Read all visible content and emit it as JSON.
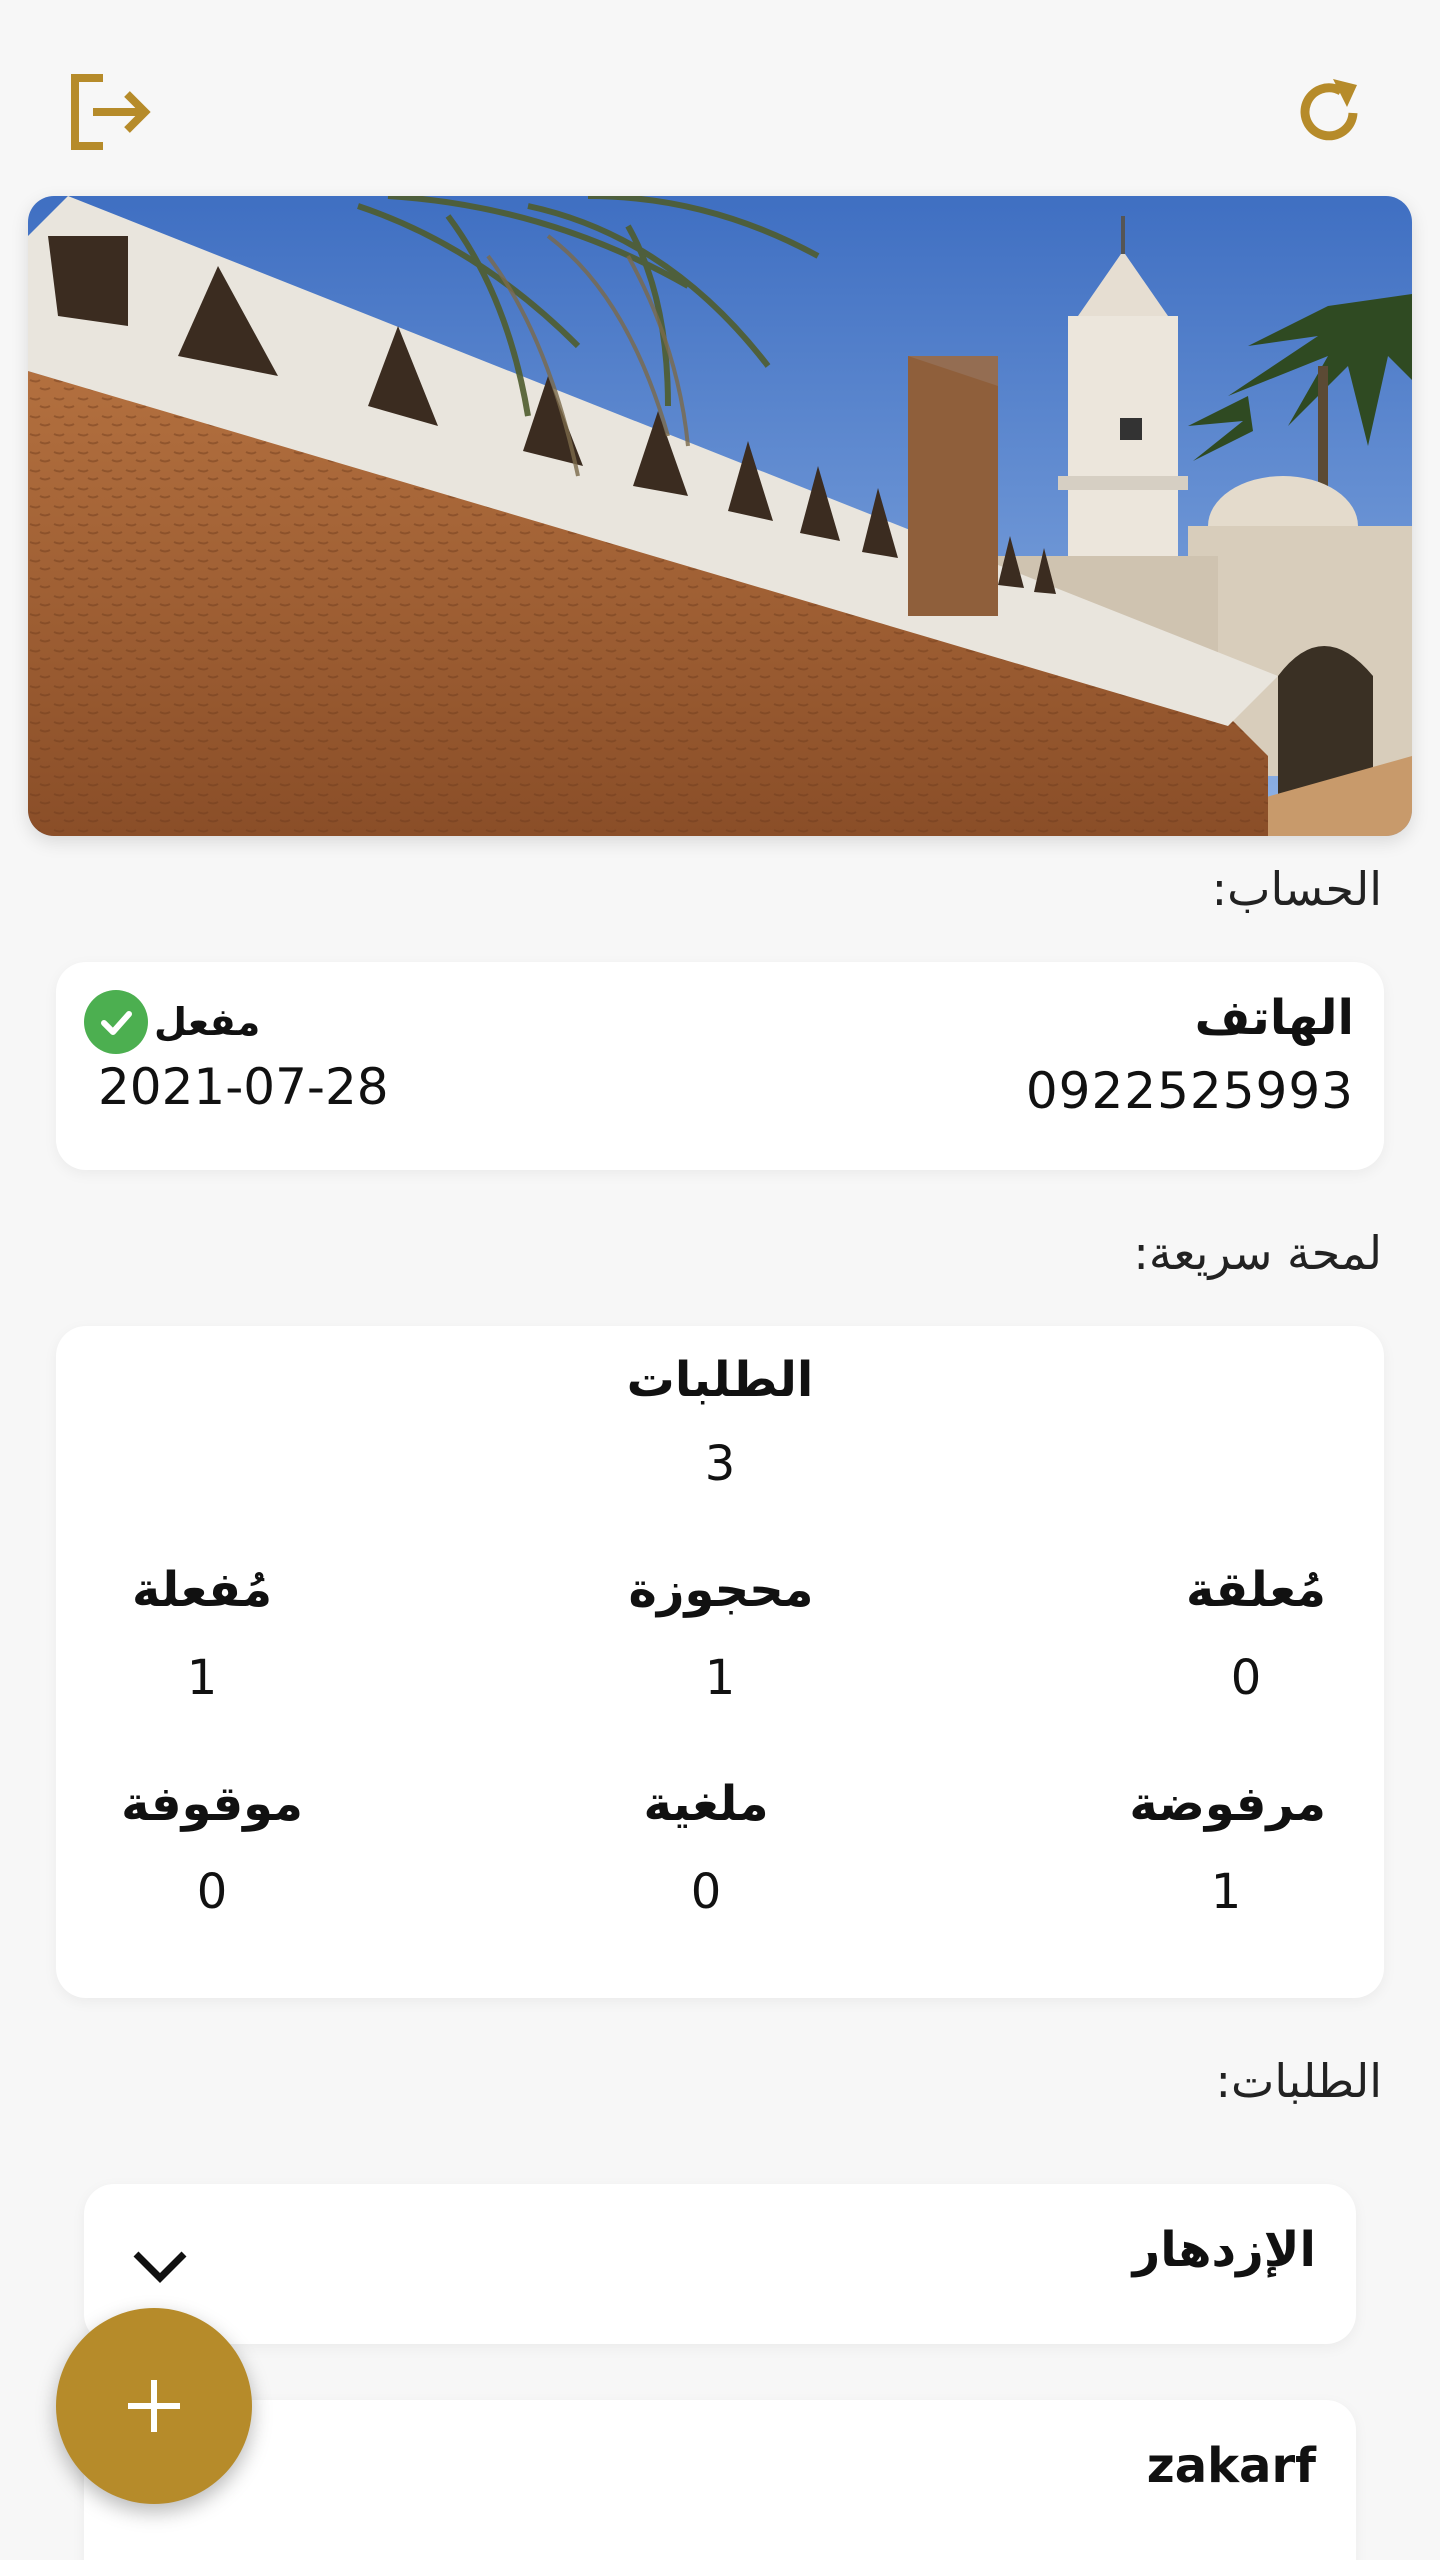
{
  "header": {
    "logout_icon": "logout-icon",
    "refresh_icon": "refresh-icon"
  },
  "colors": {
    "accent": "#b68b2a",
    "success": "#4caf50",
    "background": "#f7f7f7",
    "card": "#ffffff"
  },
  "account": {
    "section_label": "الحساب:",
    "phone_title": "الهاتف",
    "phone_value": "0922525993",
    "status_label": "مفعل",
    "date": "2021-07-28"
  },
  "quick_look": {
    "section_label": "لمحة سريعة:",
    "total": {
      "label": "الطلبات",
      "value": "3"
    },
    "stats": [
      {
        "label": "مُعلقة",
        "value": "0"
      },
      {
        "label": "محجوزة",
        "value": "1"
      },
      {
        "label": "مُفعلة",
        "value": "1"
      },
      {
        "label": "مرفوضة",
        "value": "1"
      },
      {
        "label": "ملغية",
        "value": "0"
      },
      {
        "label": "موقوفة",
        "value": "0"
      }
    ]
  },
  "orders": {
    "section_label": "الطلبات:",
    "items": [
      {
        "name": "الإزدهار"
      },
      {
        "name": "zakarf"
      }
    ]
  },
  "fab": {
    "icon": "plus-icon"
  }
}
